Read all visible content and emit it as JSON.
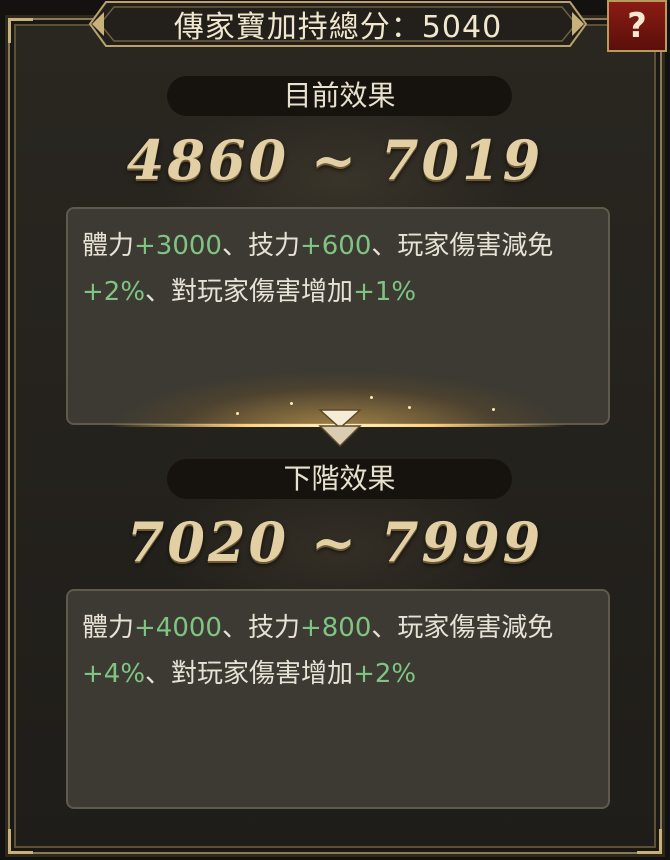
{
  "header": {
    "title": "傳家寶加持總分：5040",
    "help_label": "?"
  },
  "current": {
    "label": "目前效果",
    "range": "4860 ~ 7019",
    "effects": [
      {
        "name": "體力",
        "value": "+3000"
      },
      {
        "name": "、技力",
        "value": "+600"
      },
      {
        "name": "、玩家傷害減免",
        "value": "+2%"
      },
      {
        "name": "、對玩家傷害增加",
        "value": "+1%"
      }
    ]
  },
  "next": {
    "label": "下階效果",
    "range": "7020 ~ 7999",
    "effects": [
      {
        "name": "體力",
        "value": "+4000"
      },
      {
        "name": "、技力",
        "value": "+800"
      },
      {
        "name": "、玩家傷害減免",
        "value": "+4%"
      },
      {
        "name": "、對玩家傷害增加",
        "value": "+2%"
      }
    ]
  },
  "icons": {
    "help": "question-mark-icon",
    "arrow": "down-arrow-icon"
  },
  "colors": {
    "bonus_value": "#7fc483",
    "range_gold": "#e2cfa4",
    "help_red": "#8a1c14"
  }
}
